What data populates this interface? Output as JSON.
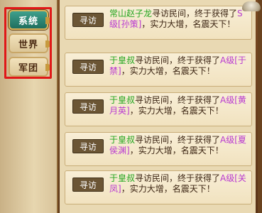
{
  "sidebar": {
    "tabs": [
      {
        "label": "系统",
        "active": true
      },
      {
        "label": "世界",
        "active": false
      },
      {
        "label": "军团",
        "active": false
      }
    ]
  },
  "messages": [
    {
      "tag": "寻访",
      "name": "常山赵子龙",
      "text1": "寻访民间，终于获得了",
      "reward": "S级[孙策]",
      "text2": "，实力大增，名震天下！"
    },
    {
      "tag": "寻访",
      "name": "于皇叔",
      "text1": "寻访民间，终于获得了",
      "reward": "A级[于禁]",
      "text2": "，实力大增，名震天下！"
    },
    {
      "tag": "寻访",
      "name": "于皇叔",
      "text1": "寻访民间，终于获得了",
      "reward": "A级[黄月英]",
      "text2": "，实力大增，名震天下！"
    },
    {
      "tag": "寻访",
      "name": "于皇叔",
      "text1": "寻访民间，终于获得了",
      "reward": "A级[夏侯渊]",
      "text2": "，实力大增，名震天下！"
    },
    {
      "tag": "寻访",
      "name": "于皇叔",
      "text1": "寻访民间，终于获得了",
      "reward": "A级[关凤]",
      "text2": "，实力大增，名震天下！"
    }
  ],
  "colors": {
    "highlight": "#e01818",
    "name": "#24a51f",
    "reward": "#b93ad0"
  }
}
